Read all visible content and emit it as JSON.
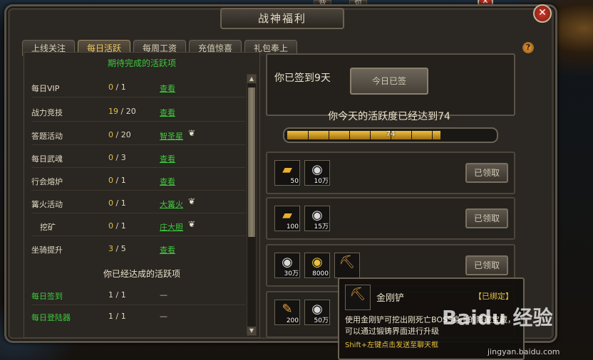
{
  "window": {
    "title": "战神福利"
  },
  "top_stubs": [
    {
      "label": "背"
    },
    {
      "label": "包"
    }
  ],
  "tabs": [
    {
      "label": "上线关注"
    },
    {
      "label": "每日活跃",
      "active": true
    },
    {
      "label": "每周工资"
    },
    {
      "label": "充值惊喜"
    },
    {
      "label": "礼包奉上"
    }
  ],
  "pending": {
    "title": "期待完成的活跃项",
    "rows": [
      {
        "name": "每日VIP",
        "current": "0",
        "total": "/ 1",
        "action": "查看",
        "wing": false
      },
      {
        "name": "战力竞技",
        "current": "19",
        "total": "/ 20",
        "action": "查看",
        "wing": false
      },
      {
        "name": "答题活动",
        "current": "0",
        "total": "/ 20",
        "action": "智圣星",
        "wing": true
      },
      {
        "name": "每日武魂",
        "current": "0",
        "total": "/ 3",
        "action": "查看",
        "wing": false
      },
      {
        "name": "行会熔炉",
        "current": "0",
        "total": "/ 1",
        "action": "查看",
        "wing": false
      },
      {
        "name": "篝火活动",
        "current": "0",
        "total": "/ 1",
        "action": "大篝火",
        "wing": true
      },
      {
        "name": "挖矿",
        "current": "0",
        "total": "/ 1",
        "action": "庄大胆",
        "wing": true
      },
      {
        "name": "坐骑提升",
        "current": "3",
        "total": "/ 5",
        "action": "查看",
        "wing": false
      }
    ]
  },
  "completed": {
    "title": "你已经达成的活跃项",
    "rows": [
      {
        "name": "每日签到",
        "progress": "1 / 1",
        "action": "—"
      },
      {
        "name": "每日登陆器",
        "progress": "1 / 1",
        "action": "—"
      }
    ]
  },
  "signin": {
    "text": "你已签到9天",
    "button": "今日已签"
  },
  "activity": {
    "text": "你今天的活跃度已经达到74",
    "value": 74,
    "max": 100,
    "label": "74"
  },
  "rewards": [
    {
      "items": [
        {
          "icon": "gold-ticket-icon",
          "glyph": "🎫",
          "qty": "50"
        },
        {
          "icon": "silver-coin-icon",
          "glyph": "⚪",
          "qty": "10万"
        }
      ],
      "button": "已领取"
    },
    {
      "items": [
        {
          "icon": "gold-ticket-icon",
          "glyph": "🎫",
          "qty": "100"
        },
        {
          "icon": "silver-coin-icon",
          "glyph": "⚪",
          "qty": "15万"
        }
      ],
      "button": "已领取"
    },
    {
      "items": [
        {
          "icon": "silver-coin-icon",
          "glyph": "⚪",
          "qty": "30万"
        },
        {
          "icon": "gold-coin-icon",
          "glyph": "🟡",
          "qty": "8000"
        },
        {
          "icon": "shovel-icon",
          "glyph": "⛏",
          "qty": ""
        }
      ],
      "button": "已领取"
    },
    {
      "items": [
        {
          "icon": "scroll-icon",
          "glyph": "📜",
          "qty": "200"
        },
        {
          "icon": "silver-coin-icon",
          "glyph": "⚪",
          "qty": "50万"
        }
      ],
      "button": ""
    }
  ],
  "tooltip": {
    "name": "金刚铲",
    "bound": "【已绑定】",
    "desc": "使用金刚铲可挖出刚死亡BOSS身上的隐藏宝藏，可以通过锻铸界面进行升级",
    "hint": "Shift+左键点击发送至聊天框"
  },
  "watermark": {
    "brand": "Baidu 经验",
    "url": "jingyan.baidu.com"
  }
}
